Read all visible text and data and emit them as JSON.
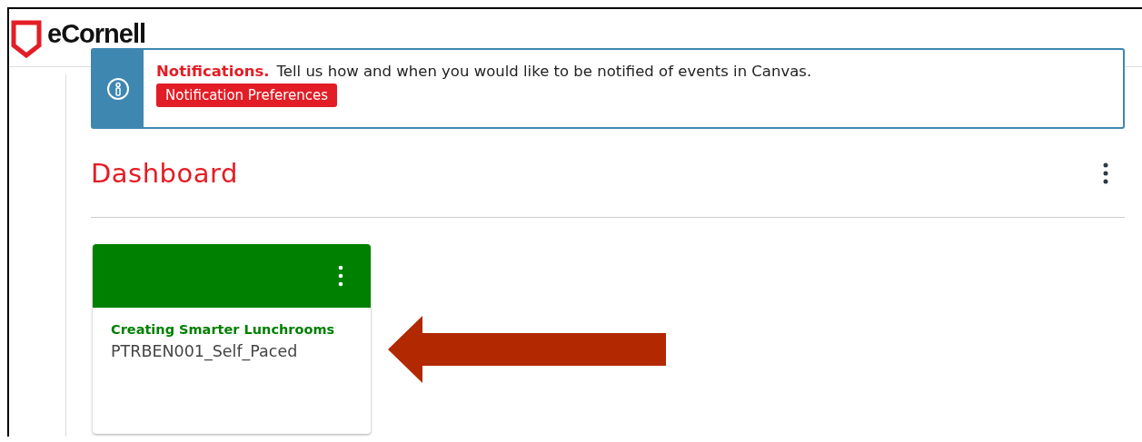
{
  "header": {
    "logo": "eCornell"
  },
  "notification": {
    "title": "Notifications.",
    "message": "Tell us how and when you would like to be notified of events in Canvas.",
    "button": "Notification Preferences"
  },
  "dashboard": {
    "title": "Dashboard"
  },
  "courses": [
    {
      "title": "Creating Smarter Lunchrooms",
      "code": "PTRBEN001_Self_Paced",
      "color": "#008000"
    }
  ]
}
